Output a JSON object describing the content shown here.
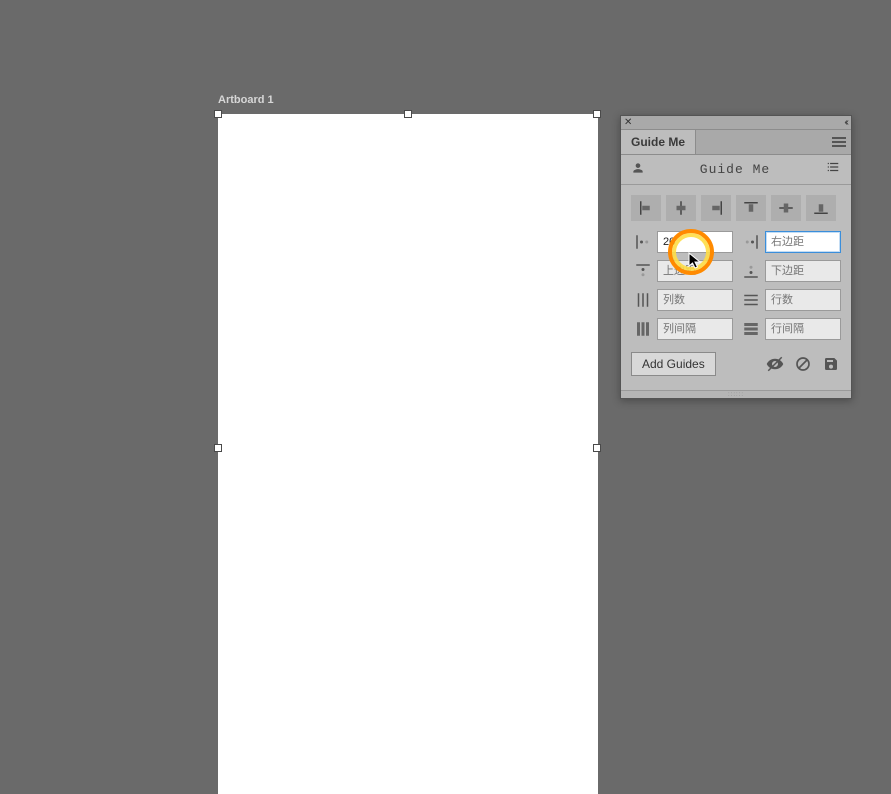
{
  "artboard": {
    "label": "Artboard 1"
  },
  "panel": {
    "tab": "Guide Me",
    "title": "Guide Me",
    "fields": {
      "left_margin": {
        "value": "20"
      },
      "right_margin": {
        "placeholder": "右边距"
      },
      "top_margin": {
        "placeholder": "上边距"
      },
      "bottom_margin": {
        "placeholder": "下边距"
      },
      "columns": {
        "placeholder": "列数"
      },
      "rows": {
        "placeholder": "行数"
      },
      "column_gap": {
        "placeholder": "列间隔"
      },
      "row_gap": {
        "placeholder": "行间隔"
      }
    },
    "add_button": "Add Guides"
  }
}
